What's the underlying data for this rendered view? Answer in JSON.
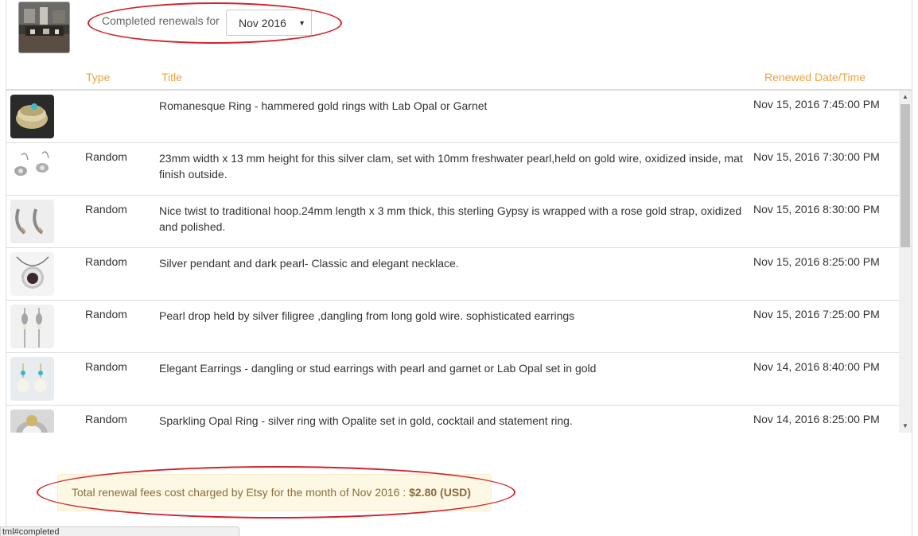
{
  "filter": {
    "label": "Completed renewals for",
    "selected_month": "Nov 2016"
  },
  "columns": {
    "type": "Type",
    "title": "Title",
    "renewed": "Renewed Date/Time"
  },
  "rows": [
    {
      "type": "",
      "title": "Romanesque Ring - hammered gold rings with Lab Opal or Garnet",
      "renewed": "Nov 15, 2016 7:45:00 PM",
      "thumb": "ring-icon"
    },
    {
      "type": "Random",
      "title": "23mm width x 13 mm height for this silver clam, set with 10mm freshwater pearl,held on gold wire, oxidized inside, mat finish outside.",
      "renewed": "Nov 15, 2016 7:30:00 PM",
      "thumb": "earring-icon"
    },
    {
      "type": "Random",
      "title": "Nice twist to traditional hoop.24mm length x 3 mm thick, this sterling Gypsy is wrapped with a rose gold strap, oxidized and polished.",
      "renewed": "Nov 15, 2016 8:30:00 PM",
      "thumb": "hoop-icon"
    },
    {
      "type": "Random",
      "title": "Silver pendant and dark pearl- Classic and elegant necklace.",
      "renewed": "Nov 15, 2016 8:25:00 PM",
      "thumb": "pendant-icon"
    },
    {
      "type": "Random",
      "title": "Pearl drop held by silver filigree ,dangling from long gold wire. sophisticated earrings",
      "renewed": "Nov 15, 2016 7:25:00 PM",
      "thumb": "drop-earring-icon"
    },
    {
      "type": "Random",
      "title": "Elegant Earrings - dangling or stud earrings with pearl and garnet or Lab Opal set in gold",
      "renewed": "Nov 14, 2016 8:40:00 PM",
      "thumb": "pearl-earring-icon"
    },
    {
      "type": "Random",
      "title": "Sparkling Opal Ring - silver ring with Opalite set in gold, cocktail and statement ring.",
      "renewed": "Nov 14, 2016 8:25:00 PM",
      "thumb": "opal-ring-icon"
    }
  ],
  "total": {
    "prefix": "Total renewal fees cost charged by Etsy for the month of Nov 2016 :",
    "amount": "$2.80 (USD)"
  },
  "status_url": "tml#completed",
  "colors": {
    "header_accent": "#f0a23e",
    "annotation_red": "#d0242b",
    "total_bg": "#fcf8e3",
    "total_text": "#8a6d3b"
  }
}
